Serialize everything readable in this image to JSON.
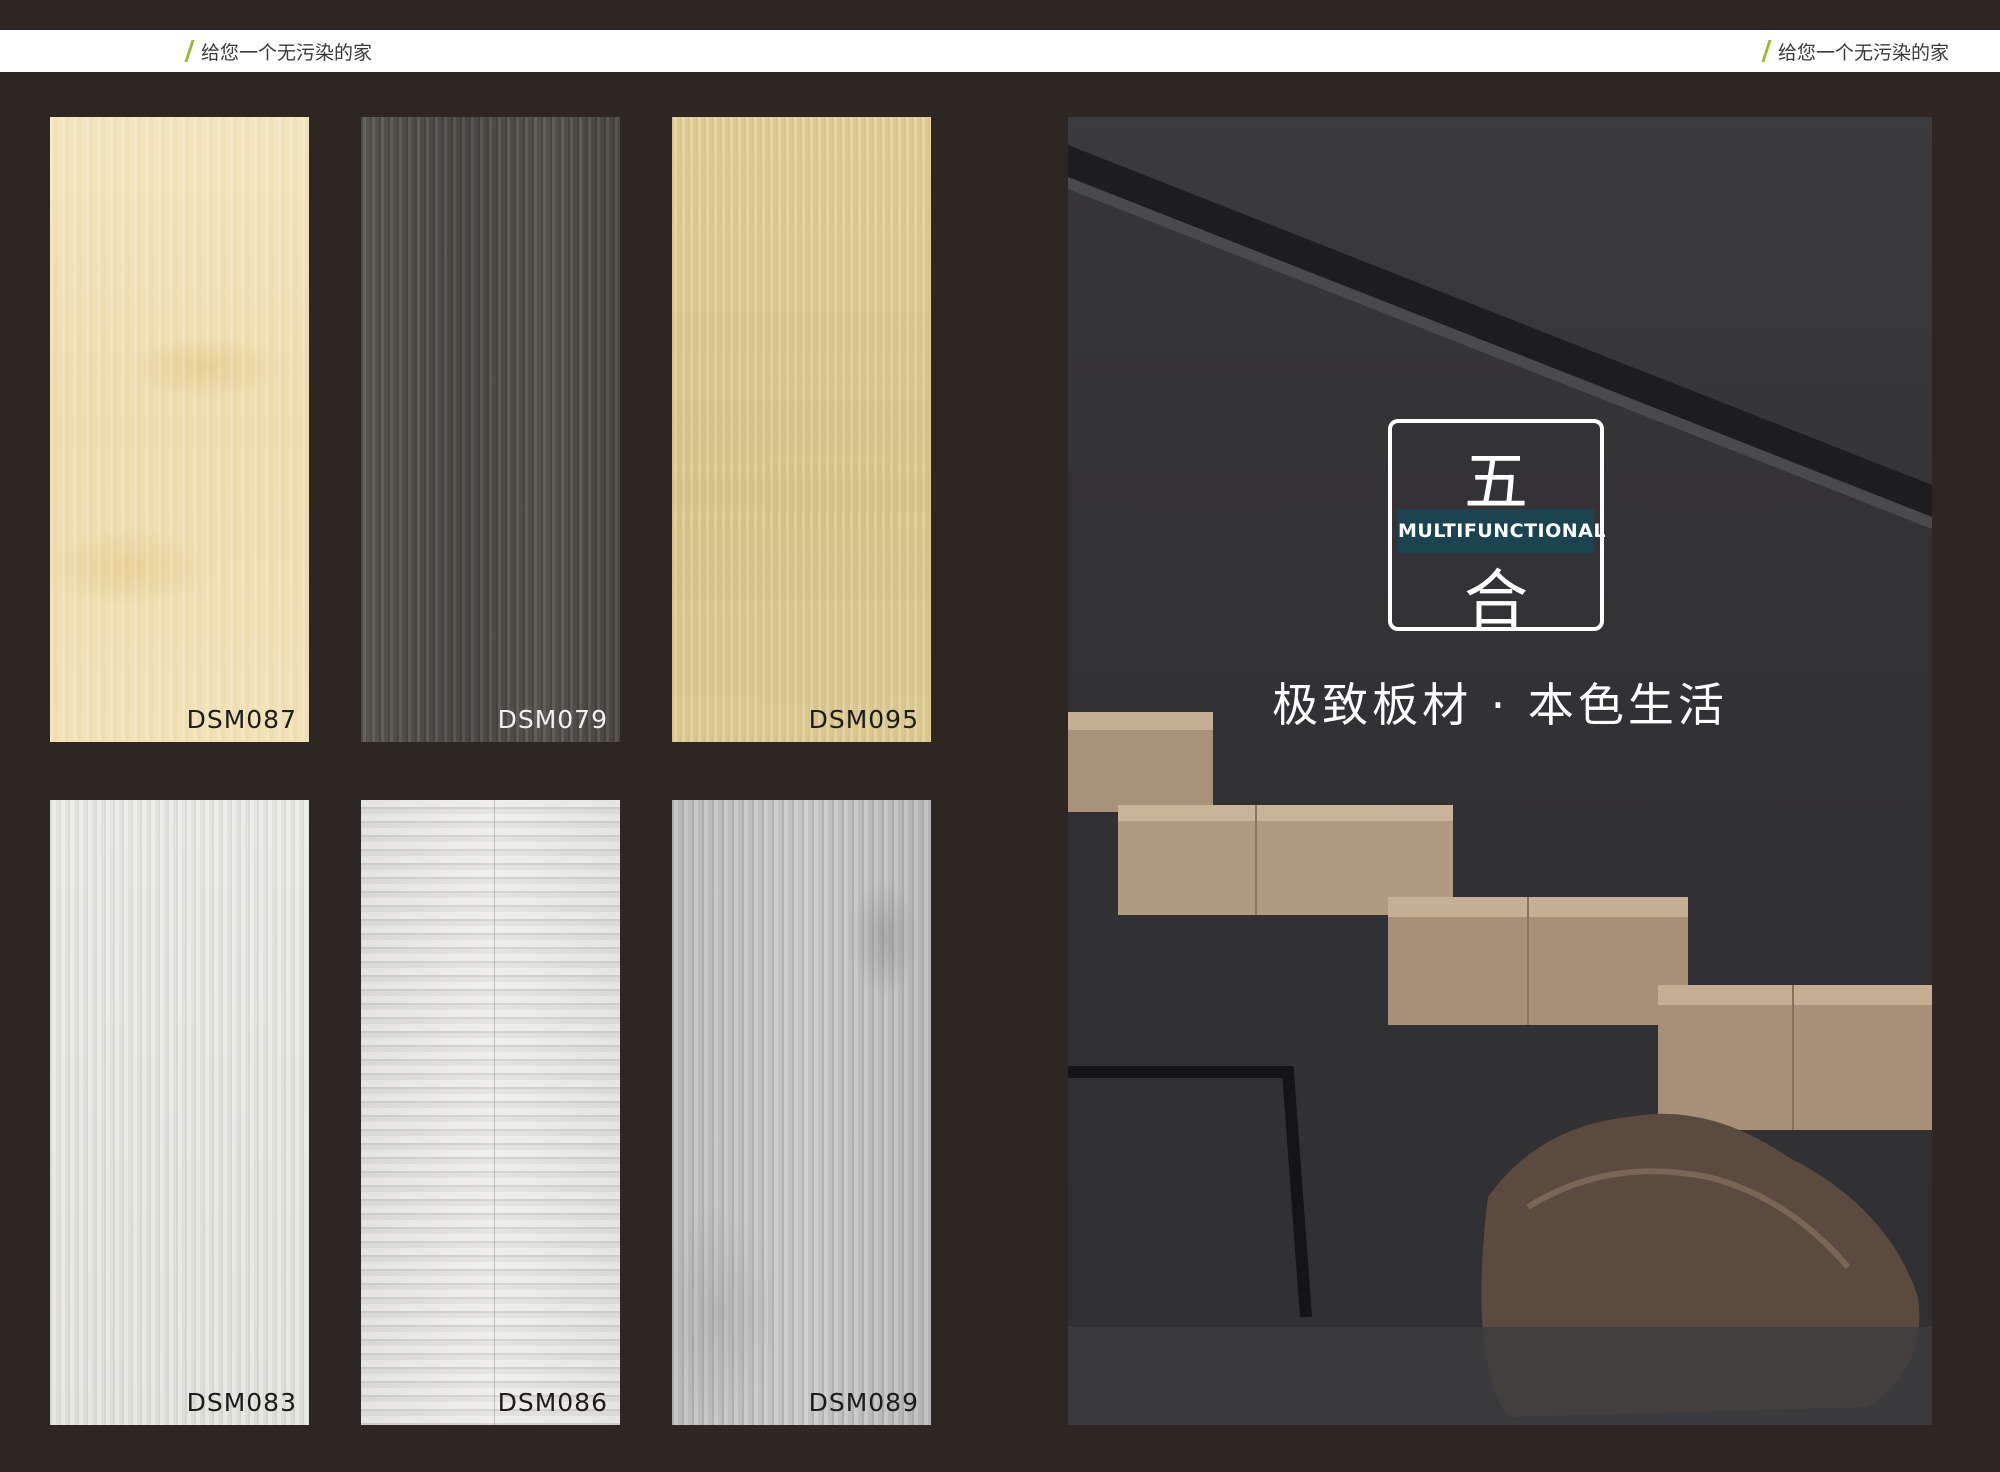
{
  "header": {
    "tagline_left": "给您一个无污染的家",
    "tagline_right": "给您一个无污染的家",
    "accent_color": "#9bb83a"
  },
  "swatches": [
    {
      "code": "DSM087"
    },
    {
      "code": "DSM079"
    },
    {
      "code": "DSM095"
    },
    {
      "code": "DSM083"
    },
    {
      "code": "DSM086"
    },
    {
      "code": "DSM089"
    }
  ],
  "feature": {
    "logo_top_char": "五",
    "logo_band_text": "MULTIFUNCTIONAL",
    "logo_bottom_char": "合",
    "slogan": "极致板材 · 本色生活",
    "band_color": "#1b4350"
  }
}
